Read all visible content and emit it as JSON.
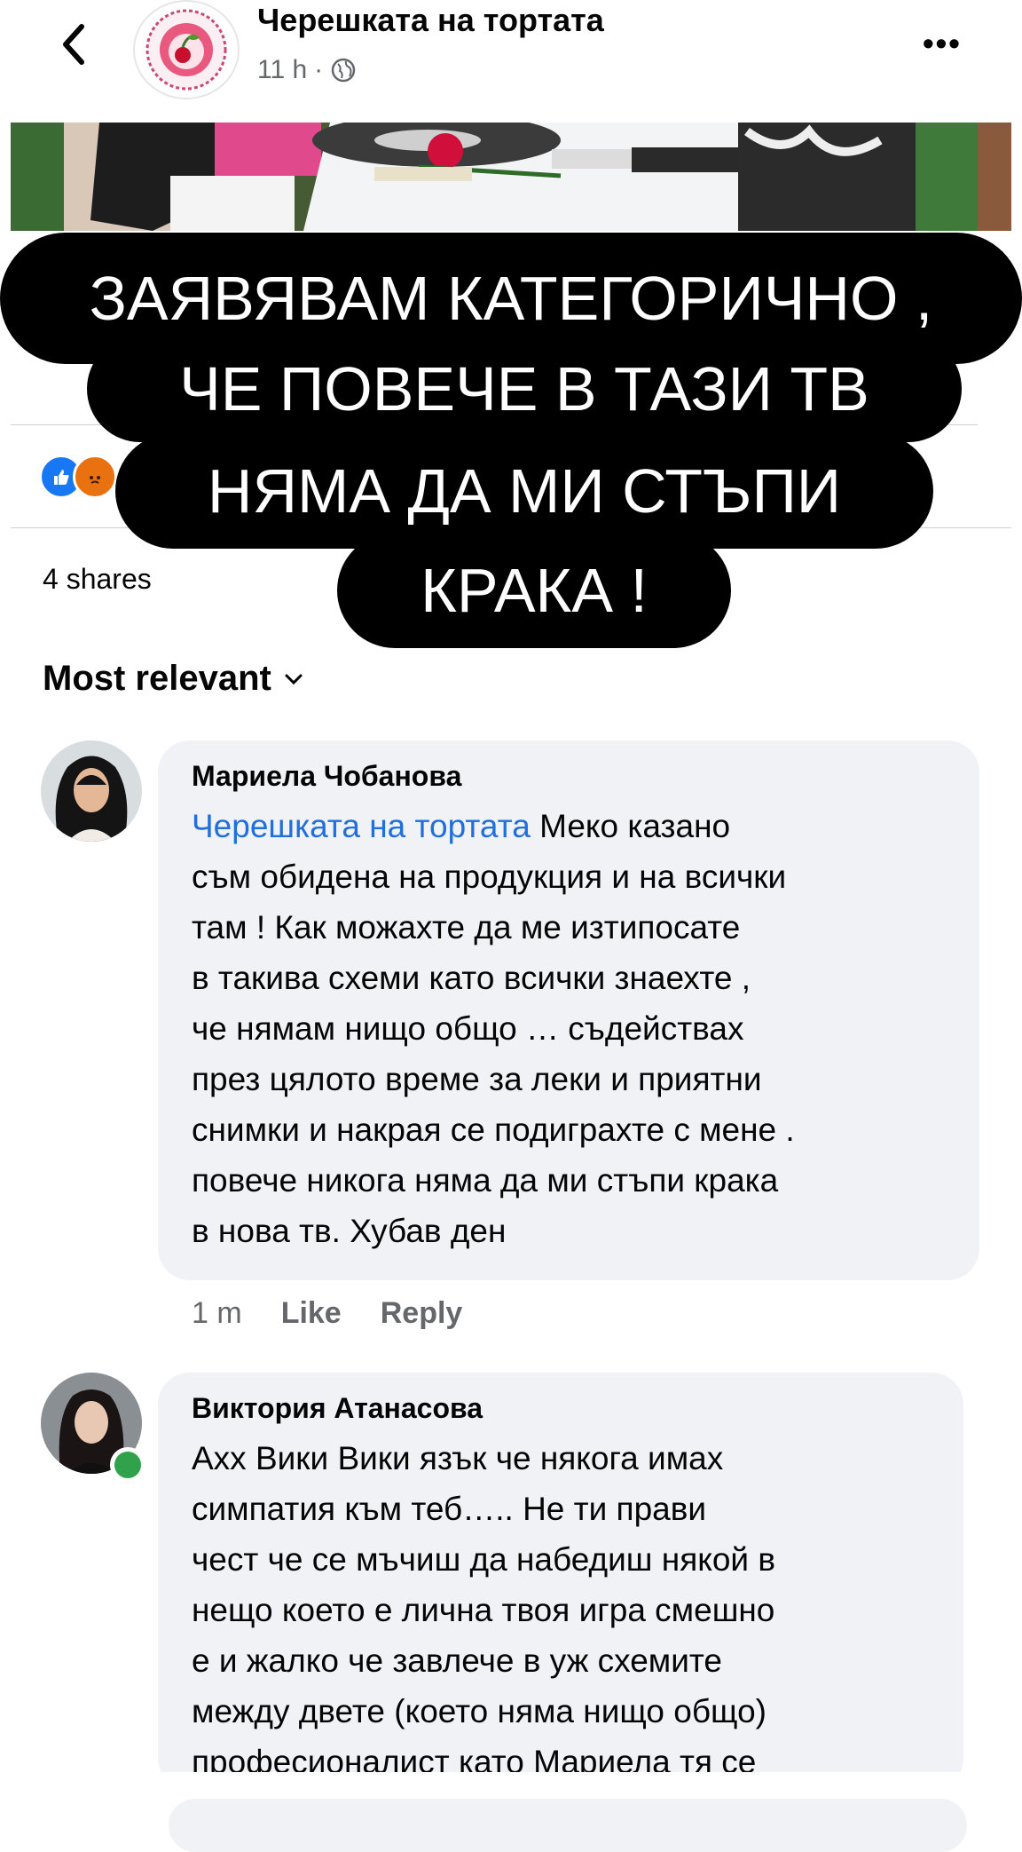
{
  "header": {
    "page_name": "Черешката на тортата",
    "time": "11 h",
    "separator": "·",
    "more_label": "•••"
  },
  "post": {
    "shares": "4 shares"
  },
  "overlay_caption": {
    "line1": "ЗАЯВЯВАМ КАТЕГОРИЧНО ,",
    "line2": "ЧЕ ПОВЕЧЕ В ТАЗИ ТВ",
    "line3": "НЯМА ДА МИ СТЪПИ",
    "line4": "КРАКА !"
  },
  "sort": {
    "label": "Most relevant"
  },
  "comments": [
    {
      "author": "Мариела Чобанова",
      "mention": "Черешката на тортата",
      "lines": [
        " Меко казано",
        "съм обидена на продукция и на всички",
        "там ! Как можахте да ме изтипосате",
        "в такива схеми като всички знаехте ,",
        "че нямам нищо общо … съдействах",
        "през цялото време за леки и приятни",
        "снимки и накрая се подиграхте с мене .",
        "повече никога няма да ми стъпи крака",
        "в нова тв. Хубав ден"
      ],
      "time": "1 m",
      "like_label": "Like",
      "reply_label": "Reply"
    },
    {
      "author": "Виктория Атанасова",
      "lines": [
        "Ахх Вики Вики язък че някога имах",
        "симпатия към теб….. Не ти прави",
        "чест че се мъчиш да набедиш някой в",
        "нещо което е лична твоя игра смешно",
        "е и жалко че завлече в уж схемите",
        "между двете (което няма нищо общо)",
        "професионалист като Мариела тя се"
      ]
    }
  ],
  "colors": {
    "link": "#216fdb",
    "bubble": "#f0f2f5",
    "meta": "#65676b",
    "online": "#31a24c"
  }
}
